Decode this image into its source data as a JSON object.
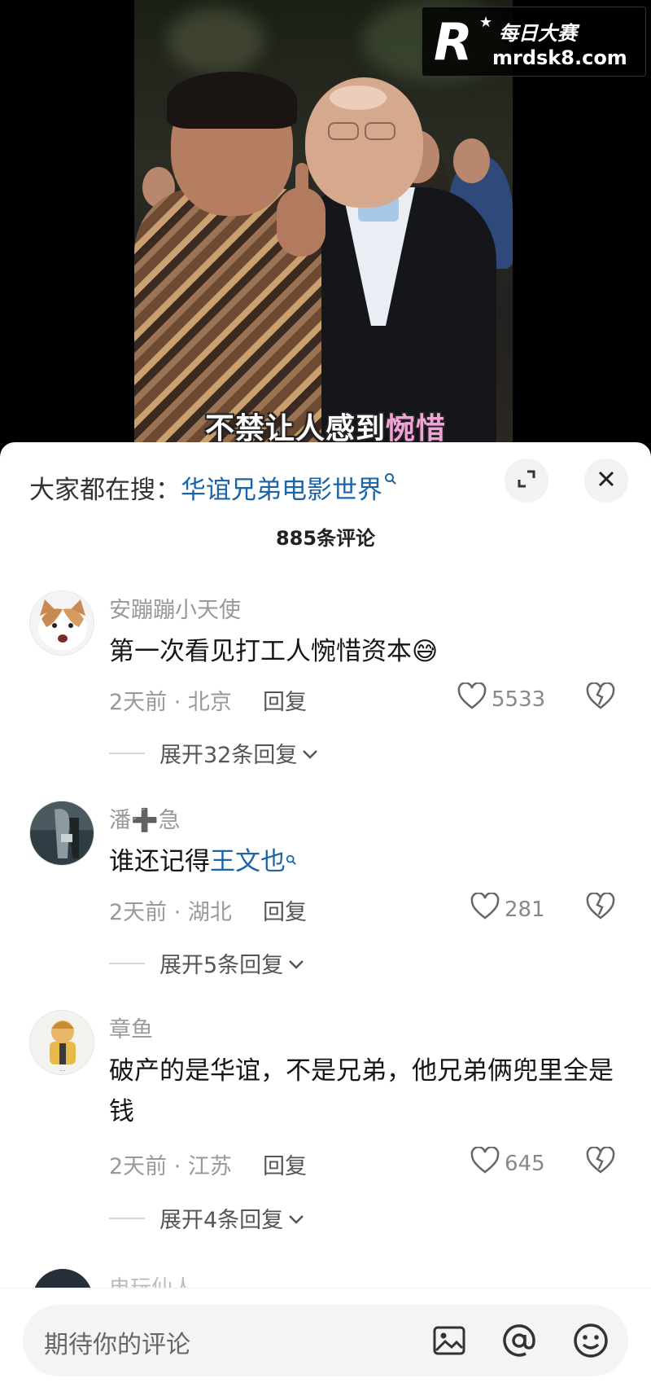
{
  "video": {
    "subtitle_prefix": "不禁让人感到",
    "subtitle_highlight": "惋惜"
  },
  "watermark": {
    "brand_cn": "每日大赛",
    "url": "mrdsk8.com",
    "mark": "R"
  },
  "sheet": {
    "search_prefix": "大家都在搜：",
    "search_term": "华谊兄弟电影世界",
    "comment_count": "885条评论"
  },
  "comments": [
    {
      "user": "安蹦蹦小天使",
      "text": "第一次看见打工人惋惜资本😅",
      "meta": "2天前 · 北京",
      "reply": "回复",
      "likes": "5533",
      "expand": "展开32条回复"
    },
    {
      "user": "潘➕急",
      "text_prefix": "谁还记得",
      "text_link": "王文也",
      "meta": "2天前 · 湖北",
      "reply": "回复",
      "likes": "281",
      "expand": "展开5条回复"
    },
    {
      "user": "章鱼",
      "text": "破产的是华谊，不是兄弟，他兄弟俩兜里全是钱",
      "meta": "2天前 · 江苏",
      "reply": "回复",
      "likes": "645",
      "expand": "展开4条回复"
    }
  ],
  "peek": {
    "user": "电玩仙人"
  },
  "bottom": {
    "input_placeholder": "期待你的评论"
  },
  "icons": {
    "expand": "expand-icon",
    "close": "close-icon",
    "like": "heart-icon",
    "dislike": "broken-heart-icon",
    "image": "image-icon",
    "mention": "at-icon",
    "emoji": "emoji-icon"
  }
}
